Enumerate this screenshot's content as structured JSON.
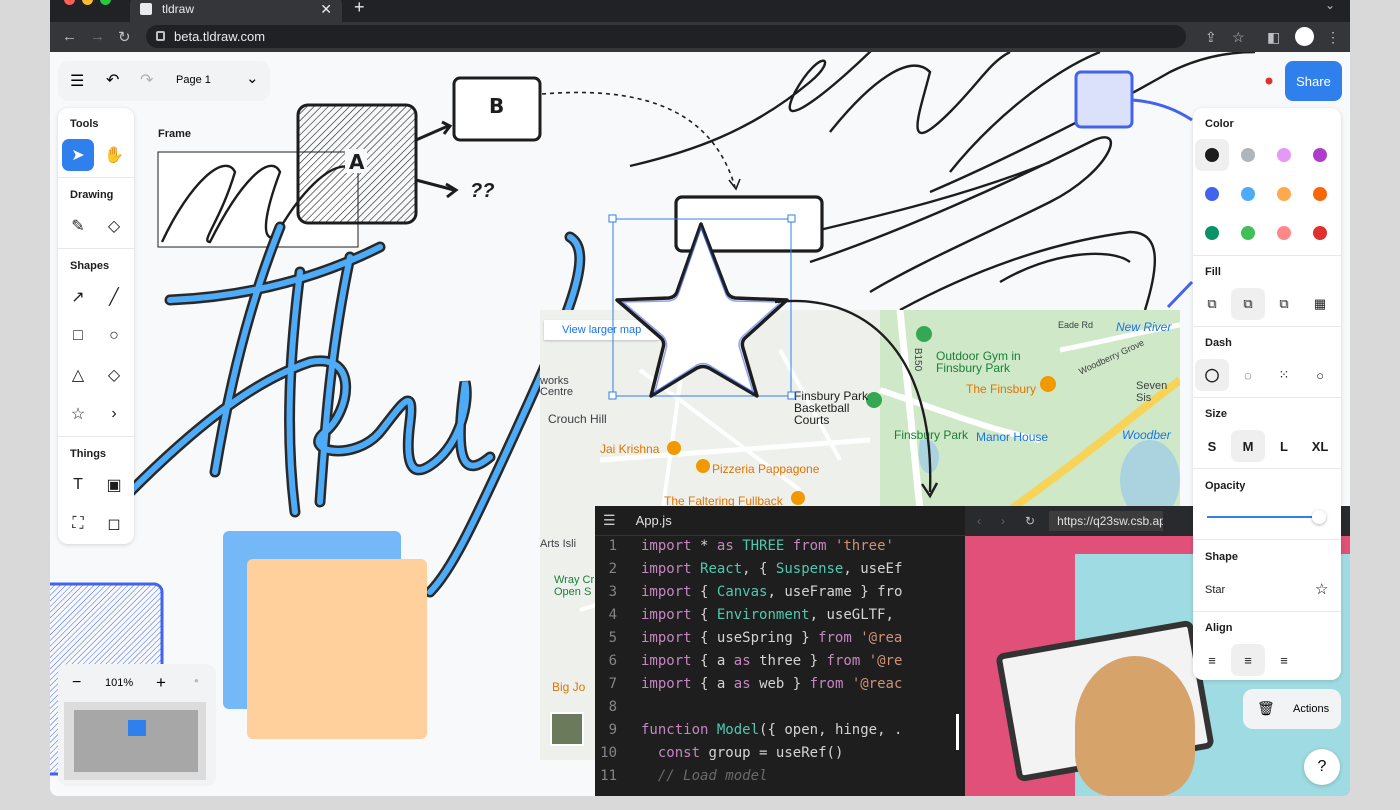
{
  "browser": {
    "tab_title": "tldraw",
    "url": "beta.tldraw.com",
    "traffic_colors": [
      "#ff5f57",
      "#febc2e",
      "#28c840"
    ]
  },
  "toolbar": {
    "page_name": "Page 1",
    "share_label": "Share"
  },
  "tools_panel": {
    "tools_label": "Tools",
    "drawing_label": "Drawing",
    "shapes_label": "Shapes",
    "things_label": "Things"
  },
  "canvas": {
    "frame_label": "Frame",
    "box_a_label": "A",
    "box_b_label": "B",
    "question_label": "??",
    "zoom": "101%"
  },
  "style_panel": {
    "color_label": "Color",
    "colors": [
      "#1d1d1d",
      "#adb5bd",
      "#e599f7",
      "#ae3ec9",
      "#4263eb",
      "#4dabf7",
      "#ffa94d",
      "#f76707",
      "#099268",
      "#40c057",
      "#ff8787",
      "#e03131"
    ],
    "fill_label": "Fill",
    "dash_label": "Dash",
    "size_label": "Size",
    "sizes": [
      "S",
      "M",
      "L",
      "XL"
    ],
    "opacity_label": "Opacity",
    "opacity": 0.95,
    "shape_label": "Shape",
    "shape_value": "Star",
    "align_label": "Align"
  },
  "actions_label": "Actions",
  "help_label": "?",
  "map": {
    "view_larger": "View larger map",
    "places": {
      "gym": "Outdoor Gym in Finsbury Park",
      "finsbury": "The Finsbury",
      "basketball": "Finsbury Park Basketball Courts",
      "crouch": "Crouch Hill",
      "jai": "Jai Krishna",
      "pizzeria": "Pizzeria Pappagone",
      "faltering": "The Faltering Fullback",
      "fpark": "Finsbury Park",
      "manor": "Manor House",
      "newriver": "New River",
      "woodber": "Woodber",
      "sevensis": "Seven Sis",
      "arts": "Arts Isli",
      "wray": "Wray Cr Open S",
      "bigjo": "Big Jo",
      "works": "works Centre",
      "eade": "Eade Rd",
      "woodberry": "Woodberry Grove",
      "b150": "B150"
    }
  },
  "editor": {
    "filename": "App.js",
    "preview_url": "https://q23sw.csb.ap",
    "lines": [
      {
        "n": "1",
        "t": "import * as THREE from 'three'"
      },
      {
        "n": "2",
        "t": "import React, { Suspense, useEf"
      },
      {
        "n": "3",
        "t": "import { Canvas, useFrame } fro"
      },
      {
        "n": "4",
        "t": "import { Environment, useGLTF,"
      },
      {
        "n": "5",
        "t": "import { useSpring } from '@rea"
      },
      {
        "n": "6",
        "t": "import { a as three } from '@re"
      },
      {
        "n": "7",
        "t": "import { a as web } from '@reac"
      },
      {
        "n": "8",
        "t": ""
      },
      {
        "n": "9",
        "t": "function Model({ open, hinge, ."
      },
      {
        "n": "10",
        "t": "  const group = useRef()"
      },
      {
        "n": "11",
        "t": "  // Load model"
      }
    ]
  }
}
